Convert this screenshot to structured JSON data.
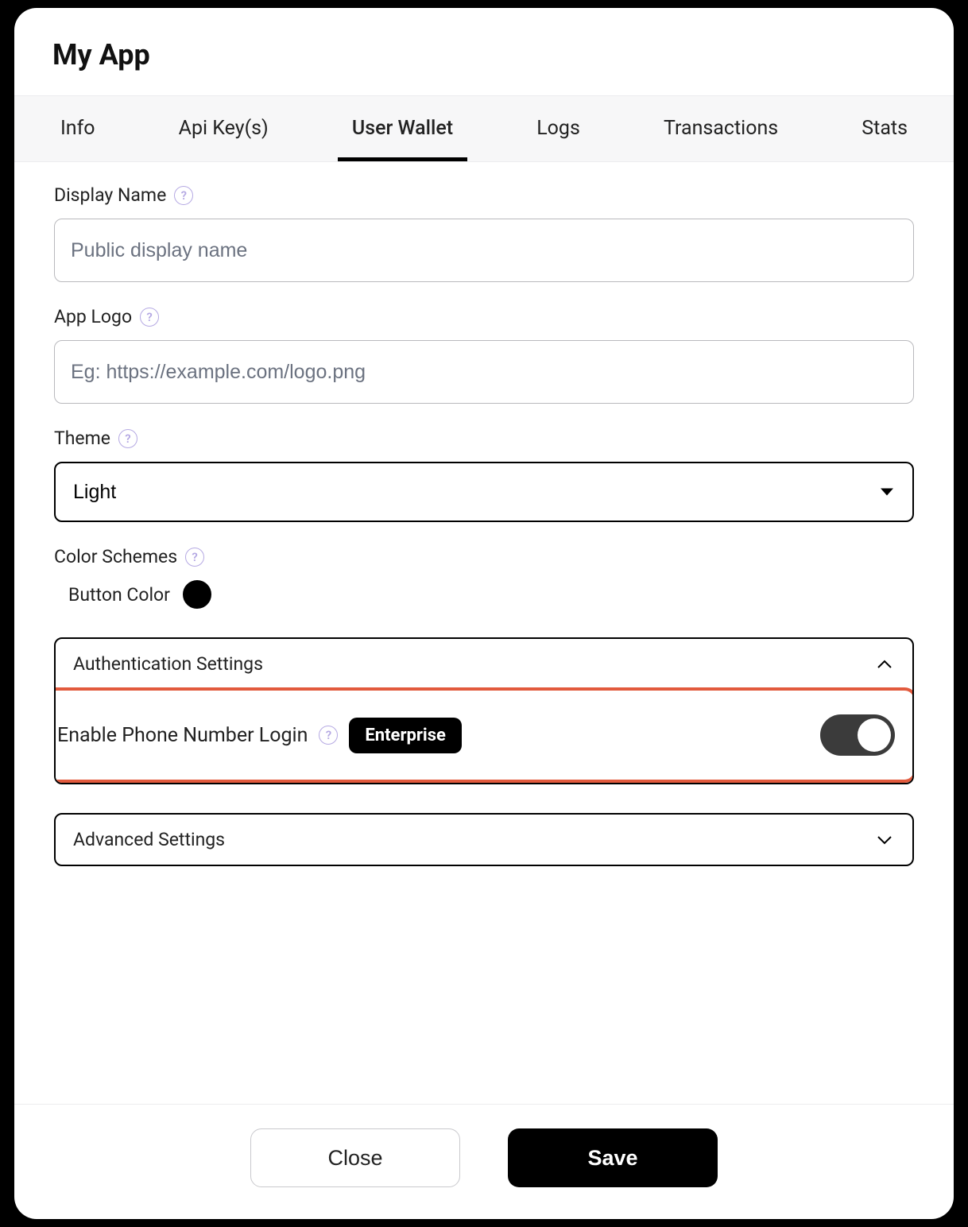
{
  "header": {
    "title": "My App"
  },
  "tabs": [
    {
      "label": "Info",
      "active": false
    },
    {
      "label": "Api Key(s)",
      "active": false
    },
    {
      "label": "User Wallet",
      "active": true
    },
    {
      "label": "Logs",
      "active": false
    },
    {
      "label": "Transactions",
      "active": false
    },
    {
      "label": "Stats",
      "active": false
    }
  ],
  "form": {
    "display_name": {
      "label": "Display Name",
      "placeholder": "Public display name",
      "value": ""
    },
    "app_logo": {
      "label": "App Logo",
      "placeholder": "Eg: https://example.com/logo.png",
      "value": ""
    },
    "theme": {
      "label": "Theme",
      "selected": "Light"
    },
    "color_schemes": {
      "label": "Color Schemes",
      "button_color_label": "Button Color",
      "button_color": "#000000"
    },
    "auth_settings": {
      "title": "Authentication Settings",
      "expanded": true,
      "phone_login": {
        "label": "Enable Phone Number Login",
        "badge": "Enterprise",
        "enabled": true
      }
    },
    "advanced_settings": {
      "title": "Advanced Settings",
      "expanded": false
    }
  },
  "footer": {
    "close": "Close",
    "save": "Save"
  },
  "icons": {
    "help": "?"
  }
}
